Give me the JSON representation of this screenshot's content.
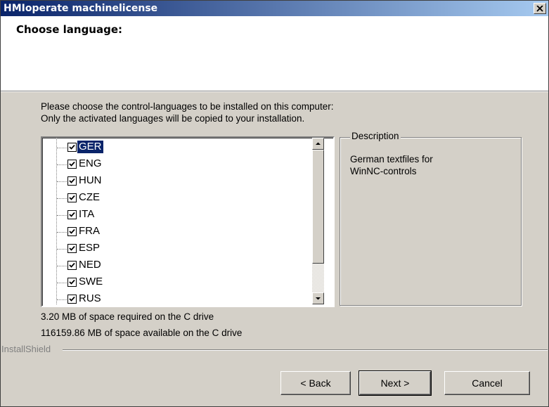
{
  "window": {
    "title": "HMIoperate machinelicense"
  },
  "header": {
    "title": "Choose language:"
  },
  "instructions": {
    "line1": "Please choose the control-languages to be installed on this computer:",
    "line2": "Only the activated languages will be copied to your installation."
  },
  "languages": [
    {
      "label": "GER",
      "checked": true,
      "selected": true
    },
    {
      "label": "ENG",
      "checked": true,
      "selected": false
    },
    {
      "label": "HUN",
      "checked": true,
      "selected": false
    },
    {
      "label": "CZE",
      "checked": true,
      "selected": false
    },
    {
      "label": "ITA",
      "checked": true,
      "selected": false
    },
    {
      "label": "FRA",
      "checked": true,
      "selected": false
    },
    {
      "label": "ESP",
      "checked": true,
      "selected": false
    },
    {
      "label": "NED",
      "checked": true,
      "selected": false
    },
    {
      "label": "SWE",
      "checked": true,
      "selected": false
    },
    {
      "label": "RUS",
      "checked": true,
      "selected": false
    }
  ],
  "description": {
    "legend": "Description",
    "text_line1": "German textfiles for",
    "text_line2": "WinNC-controls"
  },
  "space": {
    "required": "3.20 MB of space required on the C drive",
    "available": "116159.86 MB of space available on the C drive"
  },
  "footer": {
    "brand": "InstallShield",
    "back_label": "< Back",
    "next_label": "Next >",
    "cancel_label": "Cancel"
  },
  "colors": {
    "title_start": "#0a246a",
    "title_end": "#a6caf0",
    "selection": "#0a246a",
    "face": "#d4d0c8"
  }
}
